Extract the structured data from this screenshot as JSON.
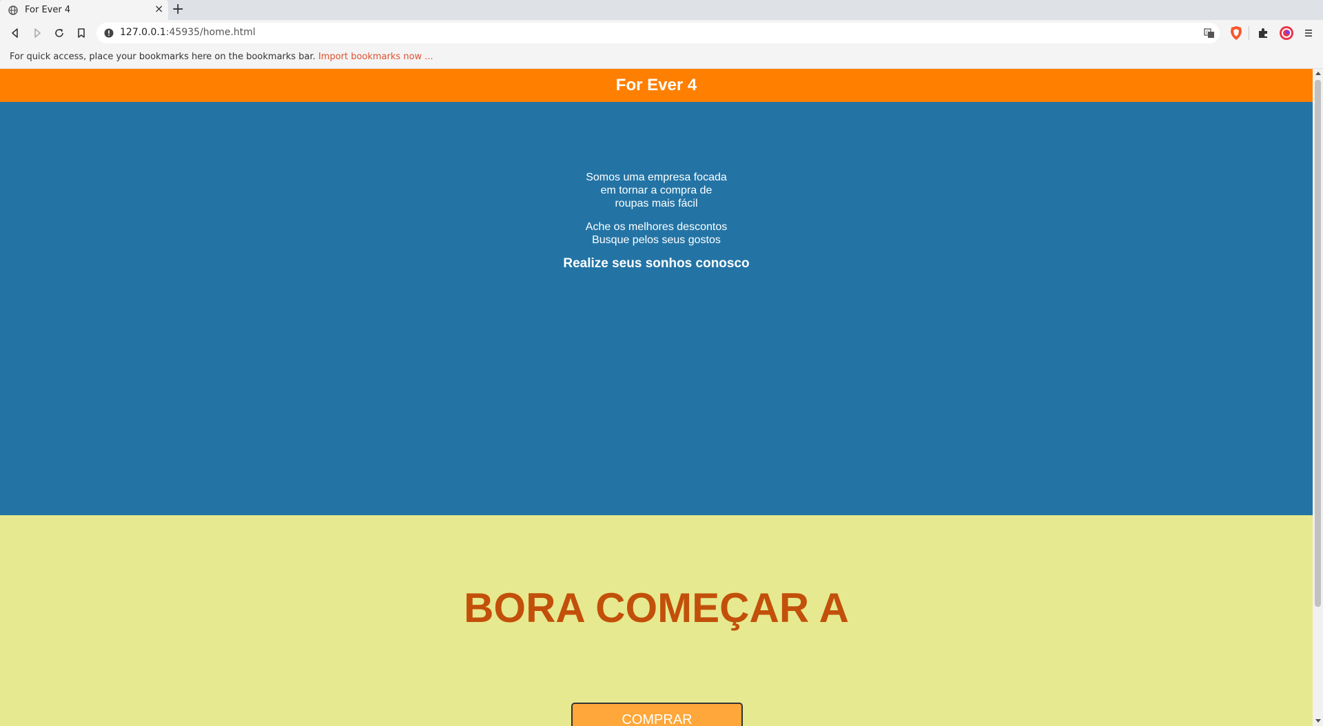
{
  "browser": {
    "tab": {
      "title": "For Ever 4",
      "favicon": "globe-icon",
      "close_glyph": "×"
    },
    "new_tab_glyph": "+",
    "address": {
      "host": "127.0.0.1",
      "rest": ":45935/home.html"
    },
    "bookmarks_bar": {
      "text": "For quick access, place your bookmarks here on the bookmarks bar.",
      "link": "Import bookmarks now ..."
    },
    "icons": [
      "back-icon",
      "forward-icon",
      "reload-icon",
      "bookmark-icon",
      "info-icon",
      "translate-icon",
      "brave-shield-icon",
      "extensions-icon",
      "wallet-icon",
      "menu-icon"
    ]
  },
  "page": {
    "header": {
      "title": "For Ever 4"
    },
    "hero": {
      "paragraph1": [
        "Somos uma empresa focada",
        "em tornar a compra de",
        "roupas mais fácil"
      ],
      "paragraph2": [
        "Ache os melhores descontos",
        "Busque pelos seus gostos"
      ],
      "tagline": "Realize seus sonhos conosco"
    },
    "cta": {
      "heading": "BORA COMEÇAR A",
      "button": "COMPRAR"
    }
  },
  "colors": {
    "header_bg": "#ff7f00",
    "hero_bg": "#2374a5",
    "cta_bg": "#e6e98f",
    "cta_heading": "#c2500a",
    "button_bg": "#ffa73a",
    "bookmark_link": "#e0502e"
  }
}
